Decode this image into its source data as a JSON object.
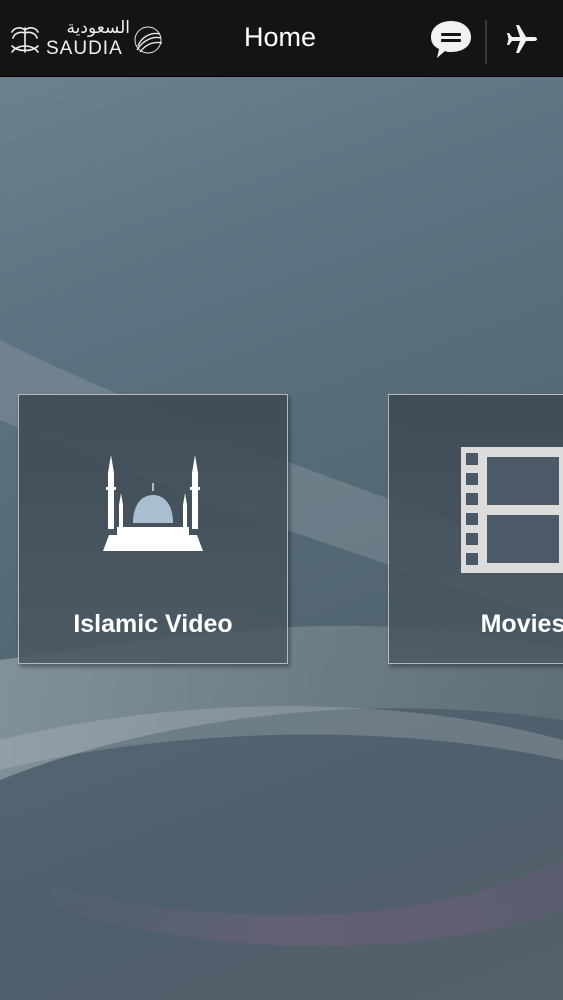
{
  "header": {
    "logo_arabic": "السعودية",
    "logo_latin": "SAUDIA",
    "title": "Home",
    "chat_icon": "chat-bubble-icon",
    "flight_icon": "airplane-icon"
  },
  "tiles": [
    {
      "label": "Islamic Video",
      "icon": "mosque-icon"
    },
    {
      "label": "Movies",
      "icon": "film-strip-icon"
    }
  ],
  "colors": {
    "header_bg": "#141414",
    "text": "#ffffff",
    "background": "#5d7280"
  }
}
